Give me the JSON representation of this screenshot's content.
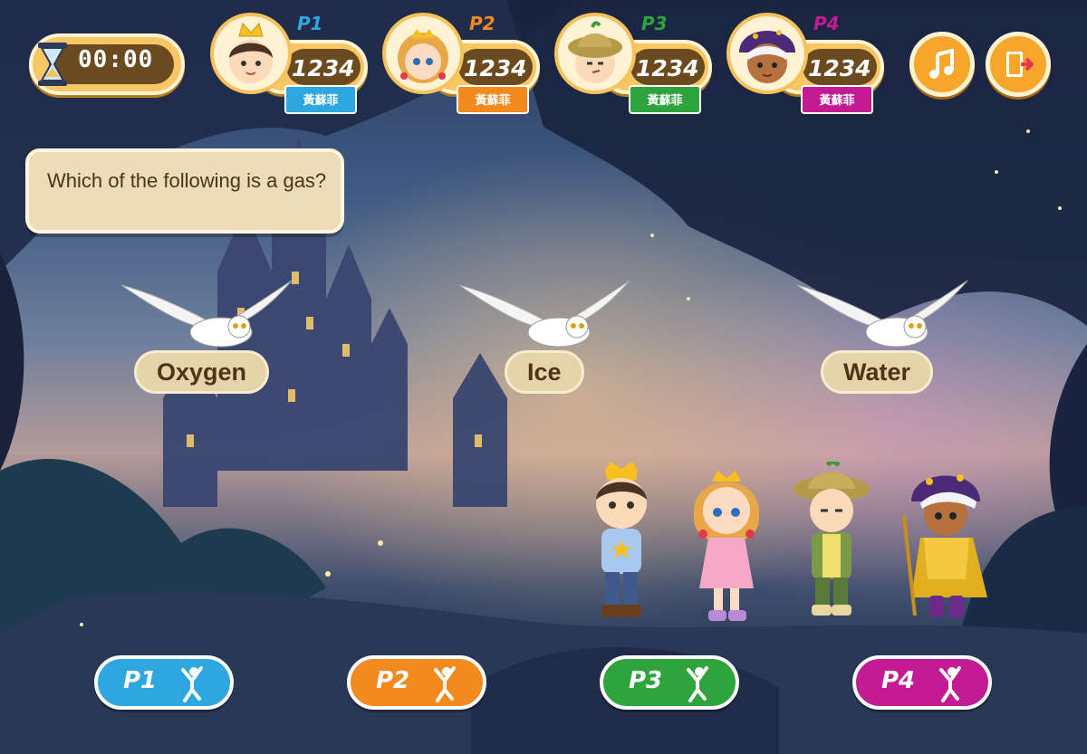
{
  "timer": {
    "value": "00:00"
  },
  "players": [
    {
      "tag": "P1",
      "score": "1234",
      "name": "黃蘇菲",
      "color": "#2ea6df"
    },
    {
      "tag": "P2",
      "score": "1234",
      "name": "黃蘇菲",
      "color": "#f28a1f"
    },
    {
      "tag": "P3",
      "score": "1234",
      "name": "黃蘇菲",
      "color": "#2fa43c"
    },
    {
      "tag": "P4",
      "score": "1234",
      "name": "黃蘇菲",
      "color": "#c41b95"
    }
  ],
  "question": {
    "text": "Which of the following is a gas?"
  },
  "answers": [
    {
      "label": "Oxygen"
    },
    {
      "label": "Ice"
    },
    {
      "label": "Water"
    }
  ],
  "bottom_buttons": [
    {
      "label": "P1",
      "color": "#2ea6df",
      "icon": "jumping-person-icon"
    },
    {
      "label": "P2",
      "color": "#f28a1f",
      "icon": "jumping-person-icon"
    },
    {
      "label": "P3",
      "color": "#2fa43c",
      "icon": "jumping-person-icon"
    },
    {
      "label": "P4",
      "color": "#c41b95",
      "icon": "jumping-person-icon"
    }
  ],
  "controls": {
    "music_icon": "music-note-icon",
    "exit_icon": "exit-door-icon"
  },
  "colors": {
    "gold": "#f7c766",
    "brown": "#6b4a1f",
    "cream": "#ecdcb8"
  }
}
